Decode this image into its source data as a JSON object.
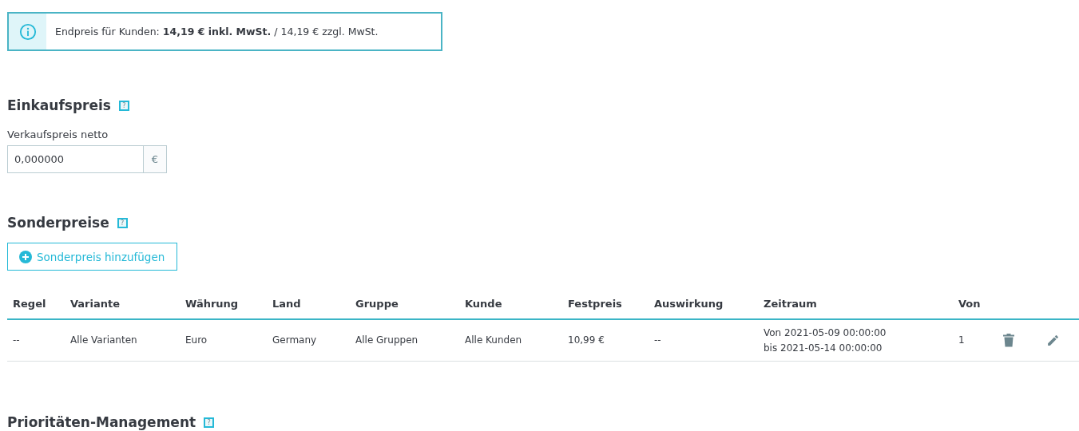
{
  "price_notice": {
    "text": "Endpreis für Kunden: **14,19 € inkl. MwSt.** / 14,19 € zzgl. MwSt."
  },
  "purchase_price": {
    "title": "Einkaufspreis",
    "help": "?",
    "field_label": "Verkaufspreis netto",
    "value": "0,000000",
    "currency": "€"
  },
  "special_prices": {
    "title": "Sonderpreise",
    "help": "?",
    "add_button": "Sonderpreis hinzufügen",
    "table": {
      "columns": [
        "Regel",
        "Variante",
        "Währung",
        "Land",
        "Gruppe",
        "Kunde",
        "Festpreis",
        "Auswirkung",
        "Zeitraum",
        "Von"
      ],
      "rows": [
        {
          "cells": [
            "--",
            "Alle Varianten",
            "Euro",
            "Germany",
            "Alle Gruppen",
            "Alle Kunden",
            "10,99 €",
            "--",
            [
              "Von 2021-05-09 00:00:00",
              "bis 2021-05-14 00:00:00"
            ],
            "1"
          ]
        }
      ]
    }
  },
  "priority_management": {
    "title": "Prioritäten-Management",
    "help": "?"
  }
}
